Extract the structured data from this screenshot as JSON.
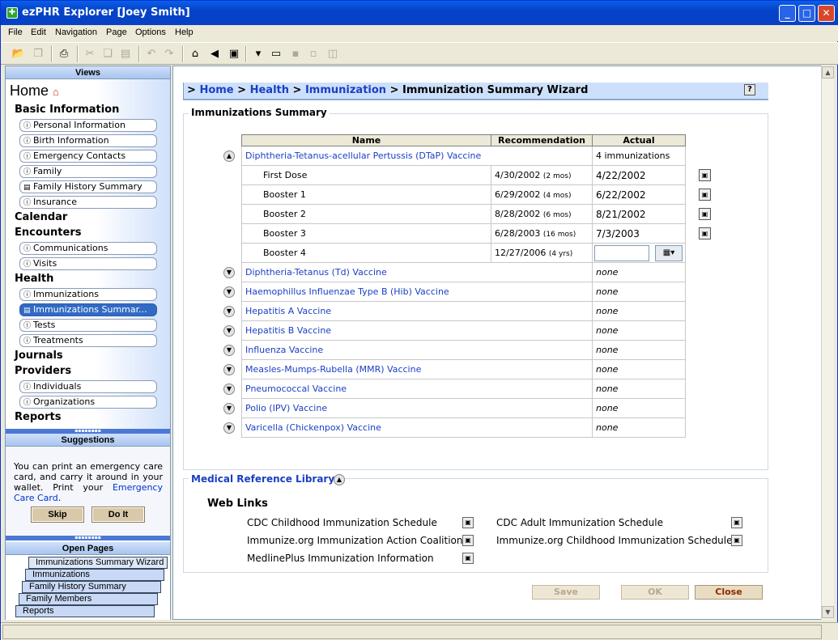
{
  "window": {
    "title": "ezPHR Explorer [Joey Smith]"
  },
  "menu": [
    "File",
    "Edit",
    "Navigation",
    "Page",
    "Options",
    "Help"
  ],
  "left": {
    "views_header": "Views",
    "home": "Home",
    "categories": {
      "basic": "Basic Information",
      "calendar": "Calendar",
      "encounters": "Encounters",
      "health": "Health",
      "journals": "Journals",
      "providers": "Providers",
      "reports": "Reports"
    },
    "items": {
      "personal": "Personal Information",
      "birth": "Birth Information",
      "emergency": "Emergency Contacts",
      "family": "Family",
      "family_history": "Family History Summary",
      "insurance": "Insurance",
      "communications": "Communications",
      "visits": "Visits",
      "immunizations": "Immunizations",
      "imm_summary": "Immunizations Summar...",
      "tests": "Tests",
      "treatments": "Treatments",
      "individuals": "Individuals",
      "organizations": "Organizations"
    },
    "suggestions_header": "Suggestions",
    "suggestion_text": "You can print an emergency care card, and carry it around in your wallet. Print your",
    "suggestion_link": "Emergency Care Card",
    "skip": "Skip",
    "doit": "Do It",
    "open_pages_header": "Open Pages",
    "open_pages": [
      "Immunizations Summary Wizard",
      "Immunizations",
      "Family History Summary",
      "Family Members",
      "Reports"
    ]
  },
  "breadcrumb": {
    "sep": ">",
    "home": "Home",
    "health": "Health",
    "immunization": "Immunization",
    "current": "Immunization Summary Wizard"
  },
  "summary": {
    "legend": "Immunizations Summary",
    "columns": {
      "name": "Name",
      "recommendation": "Recommendation",
      "actual": "Actual"
    },
    "dtap": {
      "name": "Diphtheria-Tetanus-acellular Pertussis (DTaP) Vaccine",
      "actual": "4 immunizations"
    },
    "doses": [
      {
        "name": "First Dose",
        "rec": "4/30/2002",
        "age": "(2 mos)",
        "actual": "4/22/2002"
      },
      {
        "name": "Booster 1",
        "rec": "6/29/2002",
        "age": "(4 mos)",
        "actual": "6/22/2002"
      },
      {
        "name": "Booster 2",
        "rec": "8/28/2002",
        "age": "(6 mos)",
        "actual": "8/21/2002"
      },
      {
        "name": "Booster 3",
        "rec": "6/28/2003",
        "age": "(16 mos)",
        "actual": "7/3/2003"
      },
      {
        "name": "Booster 4",
        "rec": "12/27/2006",
        "age": "(4 yrs)",
        "actual": ""
      }
    ],
    "vaccines": [
      {
        "name": "Diphtheria-Tetanus (Td) Vaccine",
        "actual": "none"
      },
      {
        "name": "Haemophillus Influenzae Type B (Hib) Vaccine",
        "actual": "none"
      },
      {
        "name": "Hepatitis A Vaccine",
        "actual": "none"
      },
      {
        "name": "Hepatitis B Vaccine",
        "actual": "none"
      },
      {
        "name": "Influenza Vaccine",
        "actual": "none"
      },
      {
        "name": "Measles-Mumps-Rubella (MMR) Vaccine",
        "actual": "none"
      },
      {
        "name": "Pneumococcal Vaccine",
        "actual": "none"
      },
      {
        "name": "Polio (IPV) Vaccine",
        "actual": "none"
      },
      {
        "name": "Varicella (Chickenpox) Vaccine",
        "actual": "none"
      }
    ]
  },
  "library": {
    "legend": "Medical Reference Library",
    "web_links_title": "Web Links",
    "links": {
      "cdc_child": "CDC Childhood Immunization Schedule",
      "cdc_adult": "CDC Adult Immunization Schedule",
      "imm_action": "Immunize.org Immunization Action Coalition",
      "imm_child": "Immunize.org Childhood Immunization Schedule",
      "medline": "MedlinePlus Immunization Information"
    }
  },
  "buttons": {
    "save": "Save",
    "ok": "OK",
    "close": "Close"
  }
}
